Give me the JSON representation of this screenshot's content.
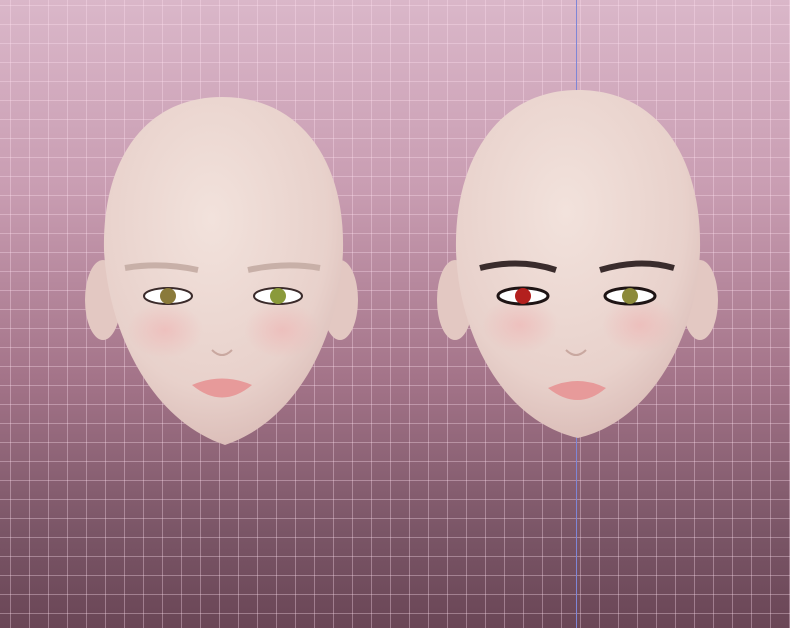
{
  "scene": {
    "background_top": "#dab7c9",
    "background_bottom": "#6a4656",
    "grid_color": "#f5dbe8",
    "axis_line_color": "#7f86d6",
    "skin_color": "#ecd9d2",
    "lip_color": "#e79a9a"
  },
  "heads": [
    {
      "eye_color": "#8a7a3a",
      "brows": "light"
    },
    {
      "eye_color_left": "#b3201e",
      "eye_color_right": "#8c8a3a",
      "brows": "dark"
    }
  ]
}
